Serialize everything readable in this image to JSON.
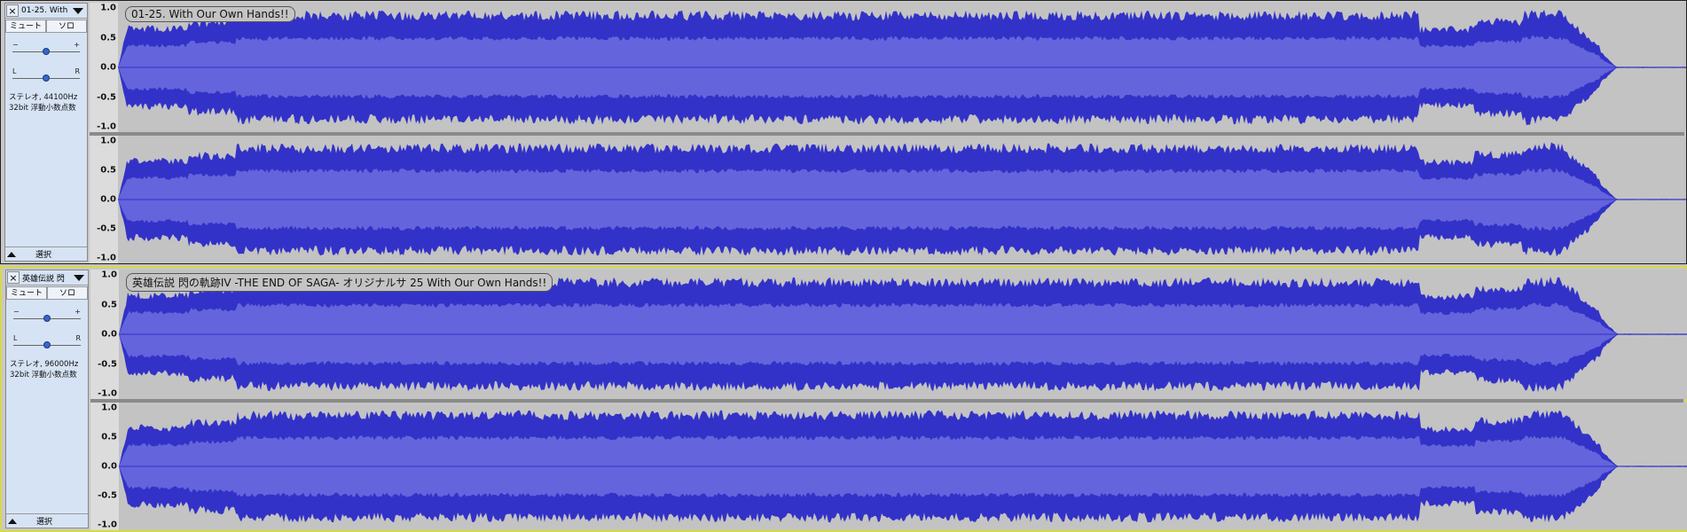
{
  "tracks": [
    {
      "name": "01-25. With",
      "clip_label": "01-25. With Our Own Hands!!",
      "mute_label": "ミュート",
      "solo_label": "ソロ",
      "gain_minus": "−",
      "gain_plus": "+",
      "pan_left": "L",
      "pan_right": "R",
      "info_line1": "ステレオ, 44100Hz",
      "info_line2": "32bit 浮動小数点数",
      "select_label": "選択",
      "gain_level": 0.5,
      "pan_level": 0.5,
      "selected": false
    },
    {
      "name": "英雄伝説 閃",
      "clip_label": "英雄伝説 閃の軌跡IV -THE END OF SAGA- オリジナルサ 25 With Our Own Hands!!",
      "mute_label": "ミュート",
      "solo_label": "ソロ",
      "gain_minus": "−",
      "gain_plus": "+",
      "pan_left": "L",
      "pan_right": "R",
      "info_line1": "ステレオ, 96000Hz",
      "info_line2": "32bit 浮動小数点数",
      "select_label": "選択",
      "gain_level": 0.5,
      "pan_level": 0.5,
      "selected": true
    }
  ],
  "ruler_ticks": [
    "1.0",
    "0.5",
    "0.0",
    "-0.5",
    "-1.0"
  ],
  "colors": {
    "wave_outer": "#3232c8",
    "wave_rms": "#6464dc",
    "background": "#c3c3c3",
    "selected_border": "#d8d84a"
  },
  "icons": {
    "close": "close-icon",
    "menu": "chevron-down-icon",
    "collapse": "collapse-up-icon"
  }
}
